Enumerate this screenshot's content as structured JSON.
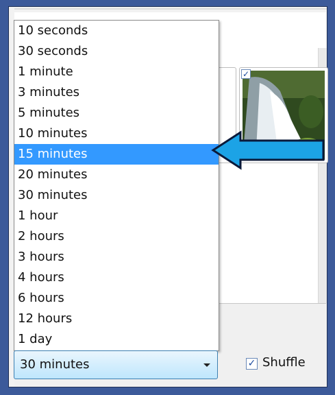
{
  "interval_dropdown": {
    "options": [
      "10 seconds",
      "30 seconds",
      "1 minute",
      "3 minutes",
      "5 minutes",
      "10 minutes",
      "15 minutes",
      "20 minutes",
      "30 minutes",
      "1 hour",
      "2 hours",
      "3 hours",
      "4 hours",
      "6 hours",
      "12 hours",
      "1 day"
    ],
    "highlighted_option": "15 minutes",
    "selected_value": "30 minutes"
  },
  "shuffle": {
    "label": "Shuffle",
    "checked": true
  },
  "picture_thumbnail": {
    "checked": true
  },
  "colors": {
    "outer_frame": "#3c5a9a",
    "highlight": "#3399ff",
    "arrow_fill": "#1ca3e6"
  },
  "icons": {
    "arrow": "left-arrow-icon",
    "dropdown": "chevron-down-icon",
    "checkbox": "checkmark-icon"
  }
}
